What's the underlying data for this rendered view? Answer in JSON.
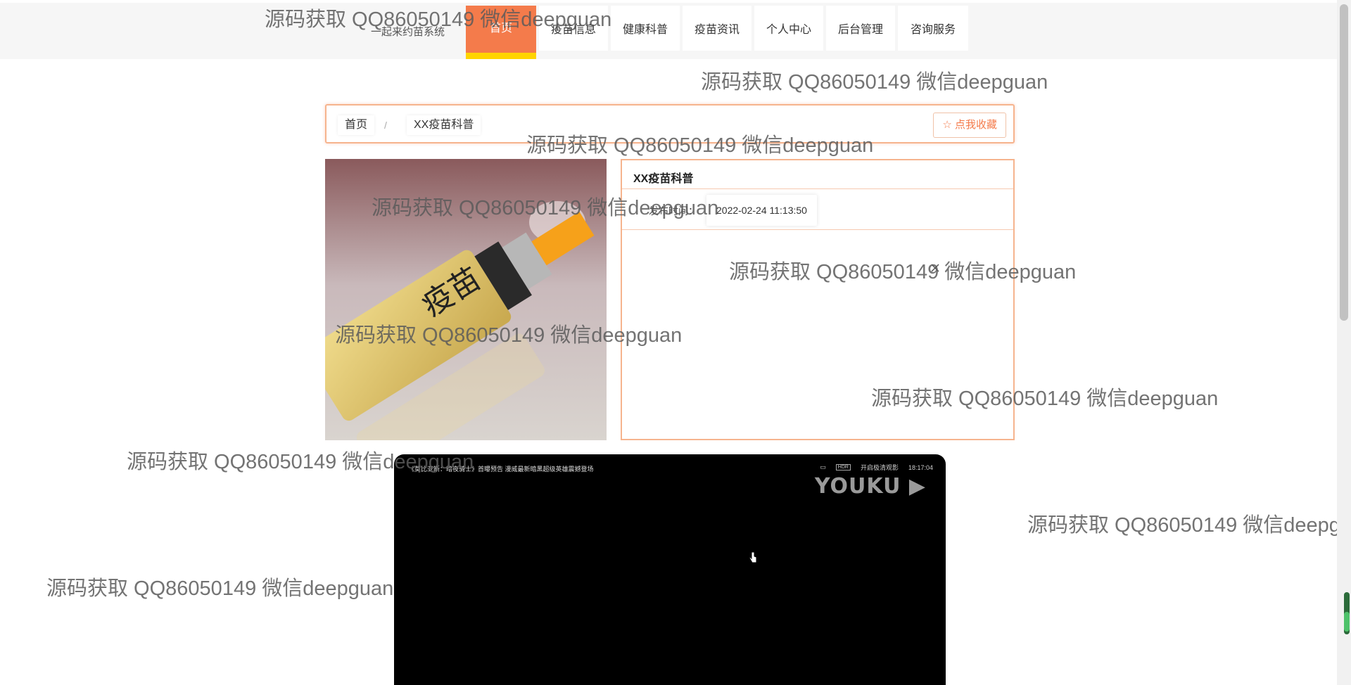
{
  "header": {
    "brand_tagline": "一起来约苗系统",
    "nav": [
      {
        "label": "首页",
        "active": true
      },
      {
        "label": "疫苗信息"
      },
      {
        "label": "健康科普"
      },
      {
        "label": "疫苗资讯"
      },
      {
        "label": "个人中心"
      },
      {
        "label": "后台管理"
      },
      {
        "label": "咨询服务"
      }
    ]
  },
  "breadcrumb": {
    "home": "首页",
    "separator": "/",
    "current": "XX疫苗科普",
    "favorite_label": "点我收藏"
  },
  "article": {
    "title": "XX疫苗科普",
    "publish_label": "发布时间：",
    "publish_time": "2022-02-24 11:13:50",
    "image_text": "疫苗"
  },
  "video": {
    "title": "《莫比亚斯：暗夜骑士》首曝预告 漫威最新暗黑超级英雄震撼登场",
    "quality_badge": "HDR",
    "quality_label": "开启极清观影",
    "clock": "18:17:04",
    "logo": "YOUKU"
  },
  "watermark": "源码获取 QQ86050149 微信deepguan",
  "colors": {
    "accent": "#f47b4b",
    "accent_underline": "#ffd400",
    "card_border": "#f6b48e"
  }
}
